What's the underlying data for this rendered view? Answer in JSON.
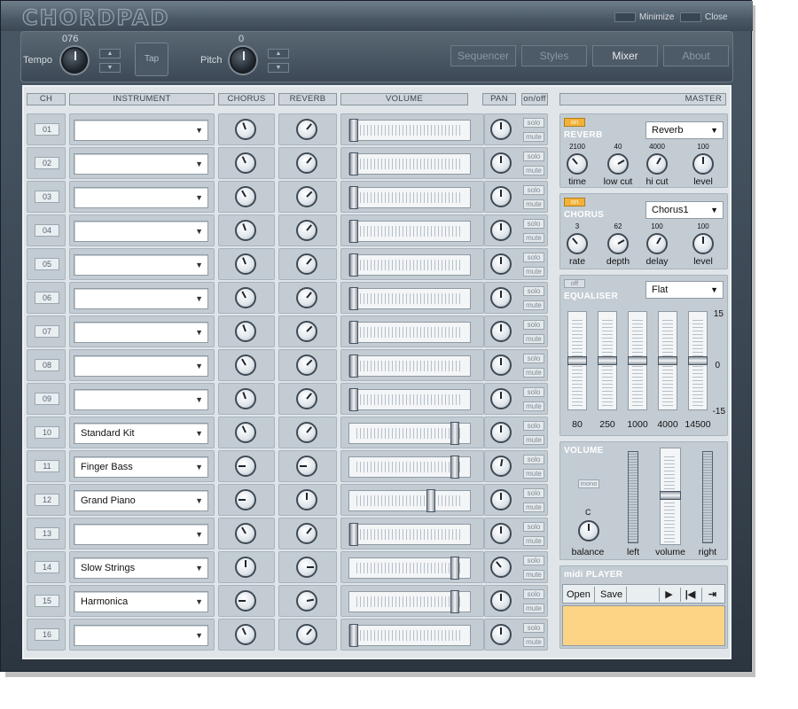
{
  "app": {
    "minimize_label": "Minimize",
    "close_label": "Close",
    "logo": "CHORDPAD"
  },
  "toolbar": {
    "tempo_label": "Tempo",
    "tempo_value": "076",
    "tap_label": "Tap",
    "pitch_label": "Pitch",
    "pitch_value": "0",
    "nav": [
      "Sequencer",
      "Styles",
      "Mixer",
      "About"
    ],
    "active_nav": "Mixer"
  },
  "headers": {
    "ch": "CH",
    "instrument": "INSTRUMENT",
    "chorus": "CHORUS",
    "reverb": "REVERB",
    "volume": "VOLUME",
    "pan": "PAN",
    "onoff": "on/off",
    "master": "MASTER"
  },
  "channel_buttons": {
    "solo": "solo",
    "mute": "mute"
  },
  "channels": [
    {
      "ch": "01",
      "instrument": "",
      "volume_pct": 0
    },
    {
      "ch": "02",
      "instrument": "",
      "volume_pct": 0
    },
    {
      "ch": "03",
      "instrument": "",
      "volume_pct": 0
    },
    {
      "ch": "04",
      "instrument": "",
      "volume_pct": 0
    },
    {
      "ch": "05",
      "instrument": "",
      "volume_pct": 0
    },
    {
      "ch": "06",
      "instrument": "",
      "volume_pct": 0
    },
    {
      "ch": "07",
      "instrument": "",
      "volume_pct": 0
    },
    {
      "ch": "08",
      "instrument": "",
      "volume_pct": 0
    },
    {
      "ch": "09",
      "instrument": "",
      "volume_pct": 0
    },
    {
      "ch": "10",
      "instrument": "Standard Kit",
      "volume_pct": 92
    },
    {
      "ch": "11",
      "instrument": "Finger Bass",
      "volume_pct": 92
    },
    {
      "ch": "12",
      "instrument": "Grand Piano",
      "volume_pct": 70
    },
    {
      "ch": "13",
      "instrument": "",
      "volume_pct": 0
    },
    {
      "ch": "14",
      "instrument": "Slow Strings",
      "volume_pct": 92
    },
    {
      "ch": "15",
      "instrument": "Harmonica",
      "volume_pct": 92
    },
    {
      "ch": "16",
      "instrument": "",
      "volume_pct": 0
    }
  ],
  "master": {
    "reverb": {
      "toggle": "on",
      "title": "REVERB",
      "preset": "Reverb",
      "knobs": [
        {
          "value": "2100",
          "label": "time"
        },
        {
          "value": "40",
          "label": "low cut"
        },
        {
          "value": "4000",
          "label": "hi cut"
        },
        {
          "value": "100",
          "label": "level"
        }
      ]
    },
    "chorus": {
      "toggle": "on",
      "title": "CHORUS",
      "preset": "Chorus1",
      "knobs": [
        {
          "value": "3",
          "label": "rate"
        },
        {
          "value": "62",
          "label": "depth"
        },
        {
          "value": "100",
          "label": "delay"
        },
        {
          "value": "100",
          "label": "level"
        }
      ]
    },
    "equaliser": {
      "toggle": "off",
      "title": "EQUALISER",
      "preset": "Flat",
      "scale_top": "15",
      "scale_mid": "0",
      "scale_bottom": "-15",
      "bands": [
        "80",
        "250",
        "1000",
        "4000",
        "14500"
      ]
    },
    "volume": {
      "title": "VOLUME",
      "mono_label": "mono",
      "balance_value": "C",
      "labels": [
        "balance",
        "left",
        "volume",
        "right"
      ]
    },
    "midi_player": {
      "title": "midi PLAYER",
      "open_label": "Open",
      "save_label": "Save",
      "screen_color": "#fdd485"
    }
  }
}
